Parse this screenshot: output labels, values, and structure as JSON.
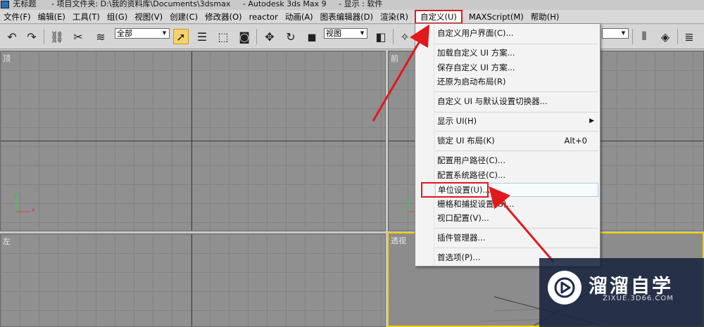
{
  "window": {
    "title_doc": "无标题",
    "title_project": "- 项目文件夹: D:\\我的资料库\\Documents\\3dsmax",
    "title_app": "- Autodesk 3ds Max 9",
    "title_display": "- 显示 : 软件"
  },
  "menubar": {
    "items": [
      "文件(F)",
      "编辑(E)",
      "工具(T)",
      "组(G)",
      "视图(V)",
      "创建(C)",
      "修改器(O)",
      "reactor",
      "动画(A)",
      "图表编辑器(D)",
      "渲染(R)",
      "自定义(U)",
      "MAXScript(M)",
      "帮助(H)"
    ],
    "active_index": 11
  },
  "toolbar": {
    "selection_filter": "全部",
    "reference_coord": "视图"
  },
  "viewports": {
    "top": "顶",
    "front": "前",
    "left": "左",
    "perspective": "透视",
    "axis_x": "x",
    "axis_y": "y"
  },
  "dropdown": {
    "items": [
      {
        "label": "自定义用户界面(C)..."
      },
      {
        "label": "加载自定义 UI 方案..."
      },
      {
        "label": "保存自定义 UI 方案..."
      },
      {
        "label": "还原为启动布局(R)"
      },
      {
        "label": "自定义 UI 与默认设置切换器..."
      },
      {
        "label": "显示 UI(H)"
      },
      {
        "label": "锁定 UI 布局(K)",
        "shortcut": "Alt+0"
      },
      {
        "label": "配置用户路径(C)..."
      },
      {
        "label": "配置系统路径(C)..."
      },
      {
        "label": "单位设置(U)..."
      },
      {
        "label": "栅格和捕捉设置(G)..."
      },
      {
        "label": "视口配置(V)..."
      },
      {
        "label": "插件管理器..."
      },
      {
        "label": "首选项(P)..."
      }
    ]
  },
  "watermark": {
    "brand": "溜溜自学",
    "url": "ZIXUE.3D66.COM"
  },
  "colors": {
    "annotation_red": "#e0191c",
    "viewport_gray": "#909090",
    "active_viewport_border": "#f4d000"
  }
}
